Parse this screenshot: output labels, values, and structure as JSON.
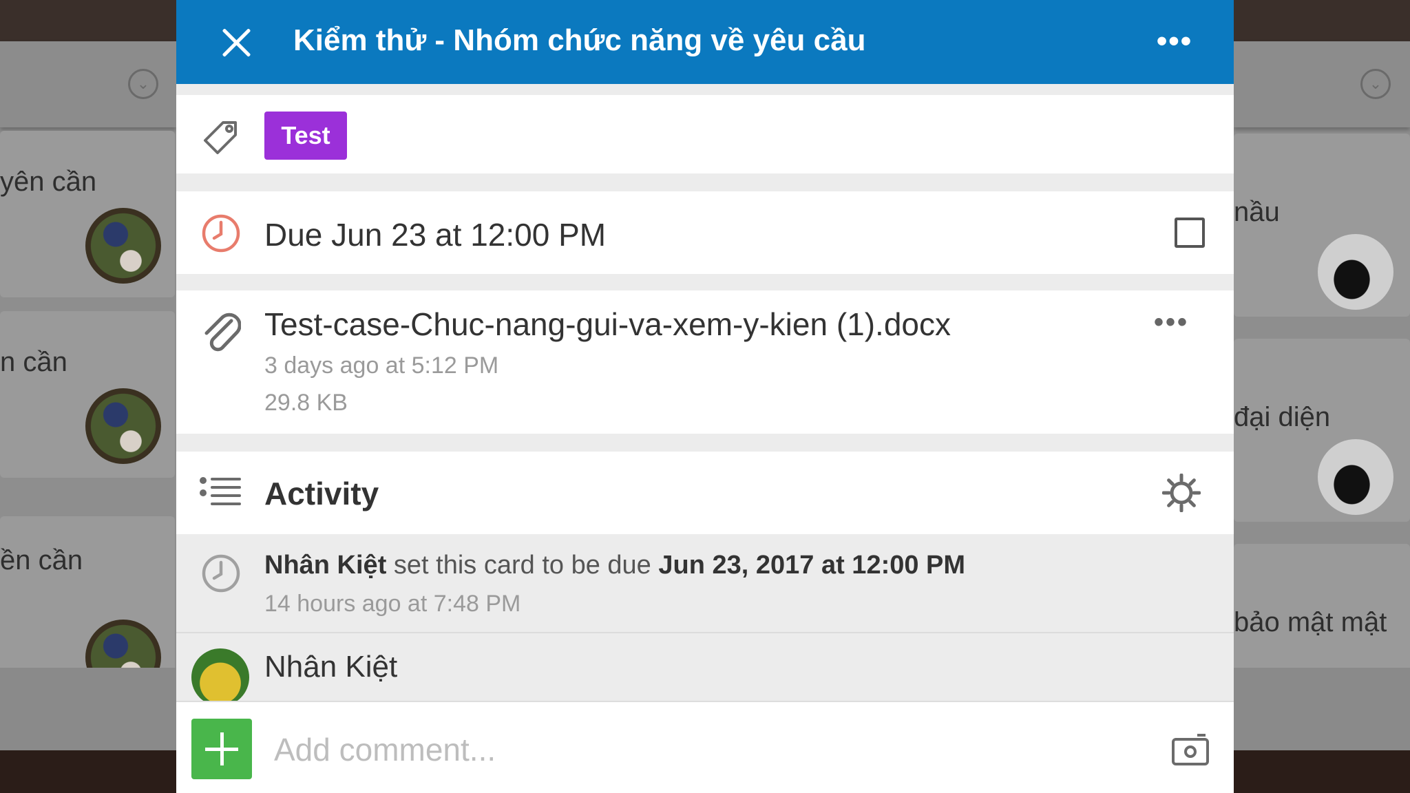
{
  "background_board": {
    "left_cards": [
      {
        "text": "yên cần"
      },
      {
        "text": "n cần"
      },
      {
        "text": "ền cần"
      }
    ],
    "right_cards": [
      {
        "text": "nầu"
      },
      {
        "text": "đại diện"
      },
      {
        "text": "bảo mật mật"
      }
    ]
  },
  "card": {
    "title": "Kiểm thử - Nhóm chức năng về yêu cầu",
    "label": "Test",
    "label_color": "#9b30d9",
    "due": "Due Jun 23 at 12:00 PM",
    "due_completed": false,
    "attachment": {
      "name": "Test-case-Chuc-nang-gui-va-xem-y-kien (1).docx",
      "time": "3 days ago at 5:12 PM",
      "size": "29.8 KB"
    }
  },
  "activity": {
    "title": "Activity",
    "items": [
      {
        "user": "Nhân Kiệt",
        "action": " set this card to be due ",
        "target": "Jun 23, 2017 at 12:00 PM",
        "time": "14 hours ago at 7:48 PM"
      }
    ],
    "commenter": "Nhân Kiệt"
  },
  "comment": {
    "placeholder": "Add comment..."
  },
  "colors": {
    "header": "#0b79bf",
    "add_button": "#49b64b",
    "due_icon": "#e87c6c"
  }
}
